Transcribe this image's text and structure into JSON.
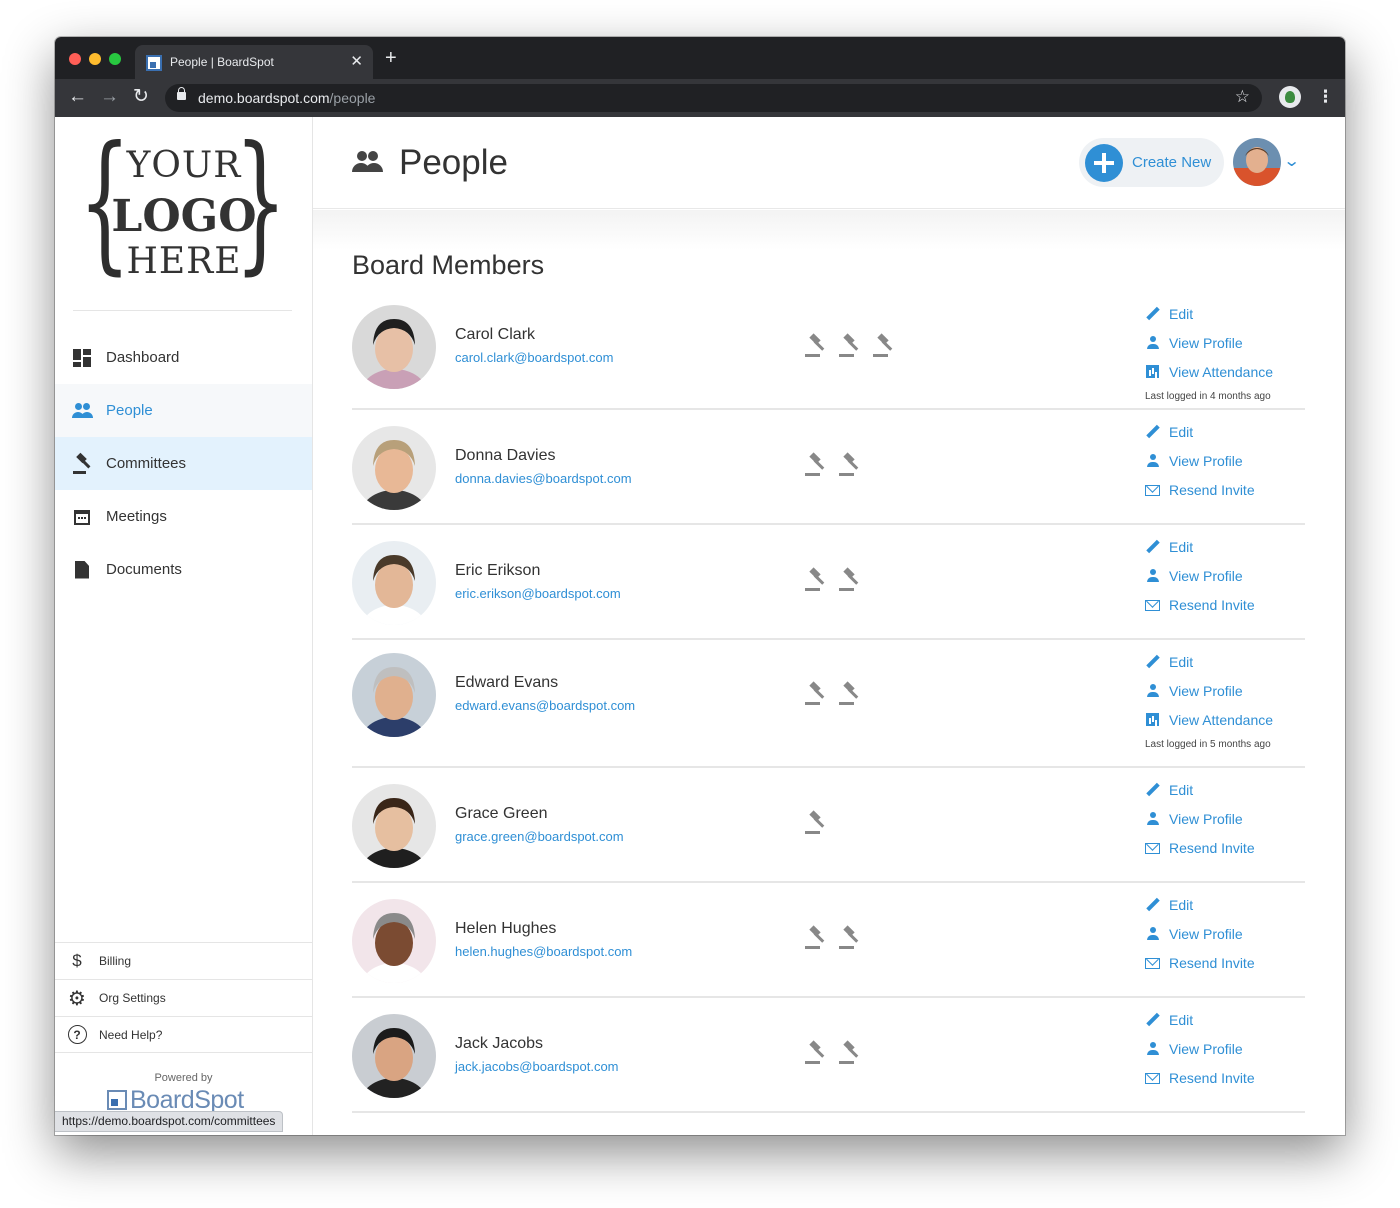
{
  "browser": {
    "tab_title": "People | BoardSpot",
    "new_tab": "+",
    "close": "✕",
    "url_host": "demo.boardspot.com",
    "url_path": "/people",
    "status_url": "https://demo.boardspot.com/committees"
  },
  "logo": {
    "your": "YOUR",
    "logo": "LOGO",
    "here": "HERE",
    "brace_open": "{",
    "brace_close": "}"
  },
  "sidebar": {
    "items": [
      {
        "label": "Dashboard",
        "icon": "dashboard-icon"
      },
      {
        "label": "People",
        "icon": "people-icon",
        "active": true
      },
      {
        "label": "Committees",
        "icon": "gavel-icon",
        "hover": true
      },
      {
        "label": "Meetings",
        "icon": "calendar-icon"
      },
      {
        "label": "Documents",
        "icon": "document-icon"
      }
    ],
    "footer": [
      {
        "label": "Billing",
        "icon": "dollar-icon",
        "glyph": "$"
      },
      {
        "label": "Org Settings",
        "icon": "gear-icon",
        "glyph": "⚙"
      },
      {
        "label": "Need Help?",
        "icon": "help-icon",
        "glyph": "?"
      }
    ],
    "powered_by": "Powered by",
    "brand": "BoardSpot"
  },
  "header": {
    "title": "People",
    "create_new": "Create New",
    "accent": "#2f8fd5"
  },
  "section_title": "Board Members",
  "actions": {
    "edit": "Edit",
    "view_profile": "View Profile",
    "view_attendance": "View Attendance",
    "resend_invite": "Resend Invite"
  },
  "members": [
    {
      "name": "Carol Clark",
      "email": "carol.clark@boardspot.com",
      "committees": 3,
      "attendance": true,
      "last_login": "Last logged in 4 months ago"
    },
    {
      "name": "Donna Davies",
      "email": "donna.davies@boardspot.com",
      "committees": 2,
      "attendance": false
    },
    {
      "name": "Eric Erikson",
      "email": "eric.erikson@boardspot.com",
      "committees": 2,
      "attendance": false
    },
    {
      "name": "Edward Evans",
      "email": "edward.evans@boardspot.com",
      "committees": 2,
      "attendance": true,
      "last_login": "Last logged in 5 months ago"
    },
    {
      "name": "Grace Green",
      "email": "grace.green@boardspot.com",
      "committees": 1,
      "attendance": false
    },
    {
      "name": "Helen Hughes",
      "email": "helen.hughes@boardspot.com",
      "committees": 2,
      "attendance": false
    },
    {
      "name": "Jack Jacobs",
      "email": "jack.jacobs@boardspot.com",
      "committees": 2,
      "attendance": false
    }
  ]
}
